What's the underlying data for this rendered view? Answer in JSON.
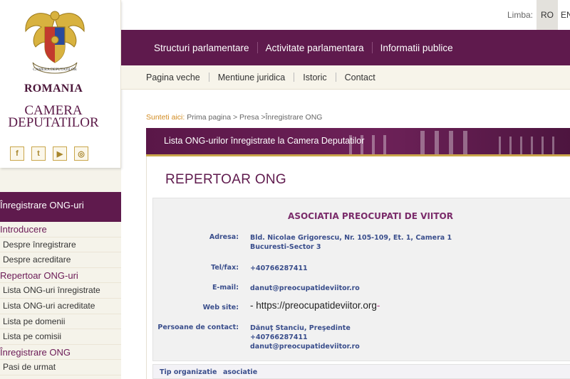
{
  "header": {
    "country": "ROMANIA",
    "institution_line1": "CAMERA",
    "institution_line2": "DEPUTATILOR",
    "coat_text": "CAMERA DEPUTATILOR",
    "lang_label": "Limba:",
    "lang_ro": "RO",
    "lang_en": "EN"
  },
  "socials": [
    {
      "icon": "facebook-icon",
      "glyph": "f"
    },
    {
      "icon": "twitter-icon",
      "glyph": "t"
    },
    {
      "icon": "youtube-icon",
      "glyph": "▶"
    },
    {
      "icon": "instagram-icon",
      "glyph": "◎"
    }
  ],
  "main_nav": [
    "Structuri parlamentare",
    "Activitate parlamentara",
    "Informatii publice"
  ],
  "sub_nav": [
    "Pagina veche",
    "Mentiune juridica",
    "Istoric",
    "Contact"
  ],
  "sidebar": {
    "heading": "Înregistrare ONG-uri",
    "items": [
      {
        "label": "Introducere",
        "type": "category"
      },
      {
        "label": "Despre înregistrare",
        "type": "item"
      },
      {
        "label": "Despre acreditare",
        "type": "item"
      },
      {
        "label": "Repertoar ONG-uri",
        "type": "category"
      },
      {
        "label": "Lista ONG-uri înregistrate",
        "type": "item"
      },
      {
        "label": "Lista ONG-uri acreditate",
        "type": "item"
      },
      {
        "label": "Lista pe domenii",
        "type": "item"
      },
      {
        "label": "Lista pe comisii",
        "type": "item"
      },
      {
        "label": "Înregistrare ONG",
        "type": "category"
      },
      {
        "label": "Pasi de urmat",
        "type": "item"
      }
    ]
  },
  "breadcrumb": {
    "lead": "Sunteti aici:",
    "path": "Prima pagina > Presa >Înregistrare ONG"
  },
  "banner": {
    "title": "Lista ONG-urilor înregistrate la Camera Deputatilor"
  },
  "page": {
    "title": "REPERTOAR ONG"
  },
  "org": {
    "name": "ASOCIATIA PREOCUPATI DE VIITOR",
    "address_label": "Adresa:",
    "address_line1": "Bld. Nicolae Grigorescu, Nr. 105-109, Et. 1, Camera 1",
    "address_line2": "Bucuresti-Sector 3",
    "phone_label": "Tel/fax:",
    "phone": "+40766287411",
    "email_label": "E-mail:",
    "email": "danut@preocupatideviitor.ro",
    "web_label": "Web site:",
    "web_prefix": "- ",
    "web_url": "https://preocupatideviitor.org",
    "web_suffix": "-",
    "contacts_label": "Persoane de contact:",
    "contact_name": "Dănuţ Stanciu, Preşedinte",
    "contact_phone": "+40766287411",
    "contact_email": "danut@preocupatideviitor.ro",
    "type_label": "Tip organizatie",
    "type_value": "asociatie"
  },
  "colors": {
    "brand": "#5f1a4d",
    "label_blue": "#3a4e8c",
    "accent_gold": "#c9a64b"
  }
}
